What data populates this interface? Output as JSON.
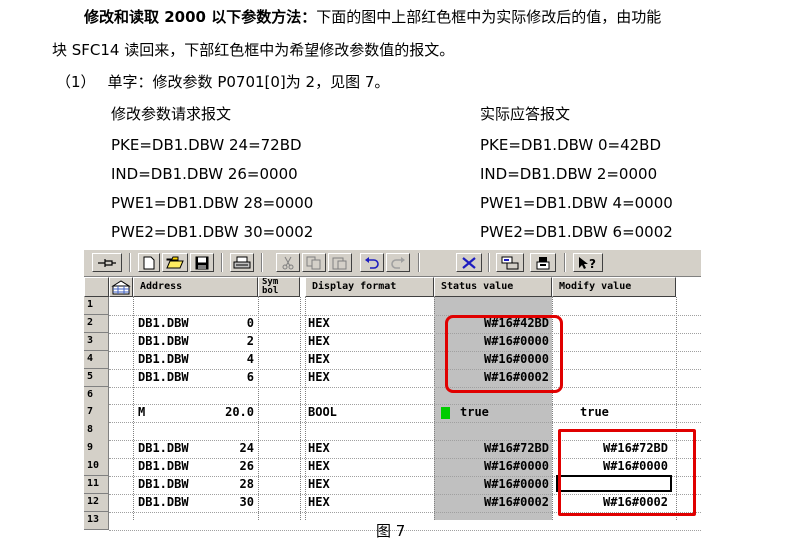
{
  "para": {
    "bold_lead": "修改和读取 2000 以下参数方法：",
    "rest1": "下面的图中上部红色框中为实际修改后的值，由功能",
    "line2": "块 SFC14 读回来，下部红色框中为希望修改参数值的报文。",
    "item_no": "（1）",
    "item_text": "单字：修改参数 P0701[0]为 2，见图 7。"
  },
  "request": {
    "title": "修改参数请求报文",
    "lines": [
      "PKE=DB1.DBW 24=72BD",
      "IND=DB1.DBW 26=0000",
      "PWE1=DB1.DBW 28=0000",
      "PWE2=DB1.DBW 30=0002"
    ]
  },
  "response": {
    "title": "实际应答报文",
    "lines": [
      "PKE=DB1.DBW 0=42BD",
      "IND=DB1.DBW 2=0000",
      "PWE1=DB1.DBW 4=0000",
      "PWE2=DB1.DBW 6=0002"
    ]
  },
  "table": {
    "headers": {
      "address": "Address",
      "symbol": "Sym bol",
      "display": "Display format",
      "status": "Status value",
      "modify": "Modify value"
    },
    "rows": [
      {
        "num": "1",
        "addr": "",
        "off": "",
        "fmt": "",
        "status": "",
        "modify": ""
      },
      {
        "num": "2",
        "addr": "DB1.DBW",
        "off": "0",
        "fmt": "HEX",
        "status": "W#16#42BD",
        "modify": ""
      },
      {
        "num": "3",
        "addr": "DB1.DBW",
        "off": "2",
        "fmt": "HEX",
        "status": "W#16#0000",
        "modify": ""
      },
      {
        "num": "4",
        "addr": "DB1.DBW",
        "off": "4",
        "fmt": "HEX",
        "status": "W#16#0000",
        "modify": ""
      },
      {
        "num": "5",
        "addr": "DB1.DBW",
        "off": "6",
        "fmt": "HEX",
        "status": "W#16#0002",
        "modify": ""
      },
      {
        "num": "6",
        "addr": "",
        "off": "",
        "fmt": "",
        "status": "",
        "modify": ""
      },
      {
        "num": "7",
        "addr": "M",
        "off": "20.0",
        "fmt": "BOOL",
        "status": "true",
        "modify": "true"
      },
      {
        "num": "8",
        "addr": "",
        "off": "",
        "fmt": "",
        "status": "",
        "modify": ""
      },
      {
        "num": "9",
        "addr": "DB1.DBW",
        "off": "24",
        "fmt": "HEX",
        "status": "W#16#72BD",
        "modify": "W#16#72BD"
      },
      {
        "num": "10",
        "addr": "DB1.DBW",
        "off": "26",
        "fmt": "HEX",
        "status": "W#16#0000",
        "modify": "W#16#0000"
      },
      {
        "num": "11",
        "addr": "DB1.DBW",
        "off": "28",
        "fmt": "HEX",
        "status": "W#16#0000",
        "modify": ""
      },
      {
        "num": "12",
        "addr": "DB1.DBW",
        "off": "30",
        "fmt": "HEX",
        "status": "W#16#0002",
        "modify": "W#16#0002"
      },
      {
        "num": "13",
        "addr": "",
        "off": "",
        "fmt": "",
        "status": "",
        "modify": ""
      }
    ]
  },
  "toolbar_icons": [
    "pin-icon",
    "new-icon",
    "open-icon",
    "save-icon",
    "print-icon",
    "cut-icon",
    "copy-icon",
    "paste-icon",
    "undo-icon",
    "redo-icon",
    "delete-icon",
    "monitor-icon",
    "modify-icon",
    "help-icon"
  ],
  "colors": {
    "highlight": "#e00000",
    "status_true": "#00cc00"
  },
  "caption": "图 7"
}
